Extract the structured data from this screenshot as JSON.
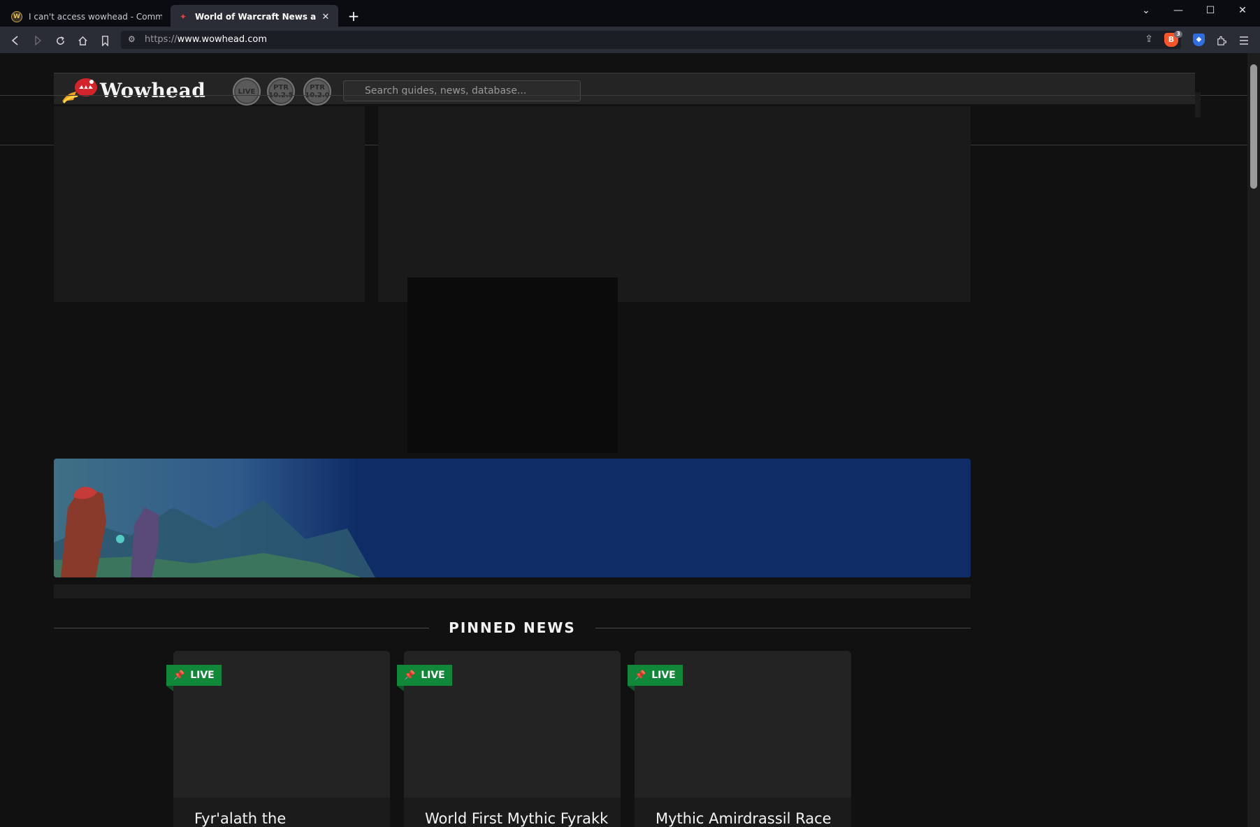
{
  "browser": {
    "tabs": [
      {
        "title": "I can't access wowhead - Community",
        "favicon": "wow-icon",
        "active": false
      },
      {
        "title": "World of Warcraft News and Gui",
        "favicon": "wowhead-icon",
        "active": true
      }
    ],
    "new_tab": "+",
    "url_protocol": "https://",
    "url_host": "www.wowhead.com",
    "brave_count": "3",
    "window_controls": {
      "menu": "⌄",
      "minimize": "—",
      "maximize": "☐",
      "close": "✕"
    }
  },
  "site": {
    "logo_text": "Wowhead",
    "versions": [
      {
        "label": "LIVE"
      },
      {
        "label": "PTR\n10.2.5"
      },
      {
        "label": "PTR\n10.2.0"
      }
    ],
    "search_placeholder": "Search guides, news, database..."
  },
  "pinned": {
    "heading": "PINNED NEWS",
    "cards": [
      {
        "badge": "LIVE",
        "title": "Fyr'alath the"
      },
      {
        "badge": "LIVE",
        "title": "World First Mythic Fyrakk"
      },
      {
        "badge": "LIVE",
        "title": "Mythic Amirdrassil Race"
      }
    ]
  },
  "colors": {
    "badge_green": "#11873a",
    "banner_blue": "#0f2c67",
    "page_bg": "#111111"
  }
}
